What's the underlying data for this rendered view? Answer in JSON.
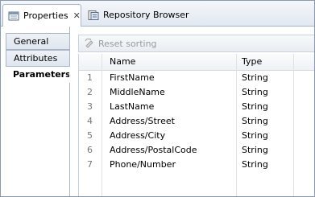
{
  "tabs": [
    {
      "label": "Properties",
      "icon": "properties-icon",
      "active": true
    },
    {
      "label": "Repository Browser",
      "icon": "repository-icon",
      "active": false
    }
  ],
  "side_tabs": [
    {
      "label": "General"
    },
    {
      "label": "Attributes"
    },
    {
      "label": "Parameters",
      "selected": true
    }
  ],
  "toolbar": {
    "reset_label": "Reset sorting",
    "icon": "reset-sorting-icon"
  },
  "table": {
    "columns": [
      "Name",
      "Type"
    ],
    "rows": [
      {
        "index": "1",
        "name": "FirstName",
        "type": "String"
      },
      {
        "index": "2",
        "name": "MiddleName",
        "type": "String"
      },
      {
        "index": "3",
        "name": "LastName",
        "type": "String"
      },
      {
        "index": "4",
        "name": "Address/Street",
        "type": "String"
      },
      {
        "index": "5",
        "name": "Address/City",
        "type": "String"
      },
      {
        "index": "6",
        "name": "Address/PostalCode",
        "type": "String"
      },
      {
        "index": "7",
        "name": "Phone/Number",
        "type": "String"
      }
    ]
  },
  "colors": {
    "frame_border": "#8a99ad",
    "tab_border": "#a8b6c8",
    "disabled_text": "#9a9a9a"
  }
}
